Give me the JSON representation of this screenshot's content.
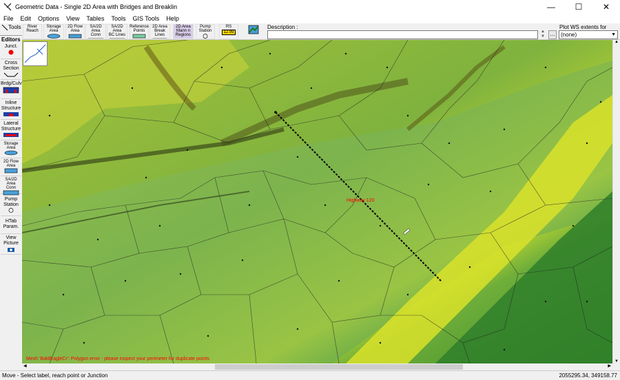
{
  "window": {
    "title": "Geometric Data - Single 2D Area with Bridges and Breaklin"
  },
  "menu": [
    "File",
    "Edit",
    "Options",
    "View",
    "Tables",
    "Tools",
    "GIS Tools",
    "Help"
  ],
  "toolbar": {
    "buttons": [
      {
        "label": "River\nReach"
      },
      {
        "label": "Storage\nArea"
      },
      {
        "label": "2D Flow\nArea"
      },
      {
        "label": "SA/2D Area\nConn"
      },
      {
        "label": "SA/2D Area\nBC Lines"
      },
      {
        "label": "Reference\nPoints"
      },
      {
        "label": "2D Area\nBreak Lines"
      },
      {
        "label": "2D Area\nMann n\nRegions"
      },
      {
        "label": "Pump\nStation"
      },
      {
        "label": "RS"
      }
    ],
    "rs_value": "12.99",
    "description_label": "Description :",
    "description_value": "",
    "plot_label": "Plot WS extents for Profile:",
    "plot_value": "(none)"
  },
  "sidebar": {
    "tools_tab": "Tools",
    "editors_tab": "Editors",
    "items": [
      {
        "label": "Junct."
      },
      {
        "label": "Cross\nSection"
      },
      {
        "label": "Brdg/Culv"
      },
      {
        "label": "Inline\nStructure"
      },
      {
        "label": "Lateral\nStructure"
      },
      {
        "label": "Storage\nArea"
      },
      {
        "label": "2D Flow\nArea"
      },
      {
        "label": "SA/2D Area\nConn"
      },
      {
        "label": "Pump\nStation"
      },
      {
        "label": "HTab\nParam."
      },
      {
        "label": "View\nPicture"
      }
    ]
  },
  "map": {
    "highway_label": "Highway 120",
    "error_message": "Mesh 'BaldEagleCr': Polygon error - please inspect your perimeter for duplicate points"
  },
  "status": {
    "left": "Move - Select label, reach point or Junction",
    "right": "2055295.34, 349158.77"
  },
  "colors": {
    "accent_red": "#ff0000",
    "terrain_dark": "#3f7a1c",
    "terrain_yellow": "#d9e22a"
  }
}
